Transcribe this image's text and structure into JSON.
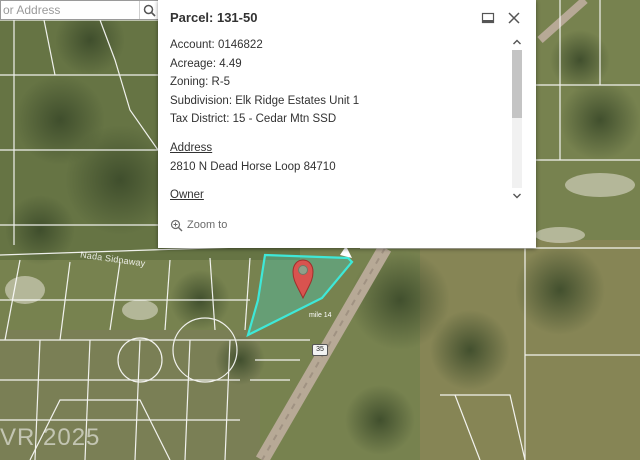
{
  "search": {
    "placeholder": "or Address",
    "icon": "search-icon"
  },
  "popup": {
    "title": "Parcel: 131-50",
    "fields": [
      {
        "label": "Account",
        "value": "0146822",
        "text": "Account: 0146822"
      },
      {
        "label": "Acreage",
        "value": "4.49",
        "text": "Acreage: 4.49"
      },
      {
        "label": "Zoning",
        "value": "R-5",
        "text": "Zoning: R-5"
      },
      {
        "label": "Subdivision",
        "value": "Elk Ridge Estates Unit 1",
        "text": "Subdivision: Elk Ridge Estates Unit 1"
      },
      {
        "label": "Tax District",
        "value": "15 - Cedar Mtn SSD",
        "text": "Tax District: 15 - Cedar Mtn SSD"
      }
    ],
    "address_heading": "Address",
    "address": "2810 N Dead Horse Loop 84710",
    "owner_heading": "Owner",
    "zoom_label": "Zoom to",
    "icons": {
      "dock": "dock-icon",
      "close": "close-icon",
      "zoom": "zoom-in-icon"
    }
  },
  "map": {
    "road_label": "Nada Sidnaway",
    "highway_shield": "35",
    "mile_marker": "mile 14",
    "watermark": "VR 2025",
    "parcel_color": "#3ee8d8",
    "pin_color": "#d9534f",
    "parcel_line_color": "#ffffff",
    "icons": {
      "pin": "map-pin-icon"
    }
  }
}
